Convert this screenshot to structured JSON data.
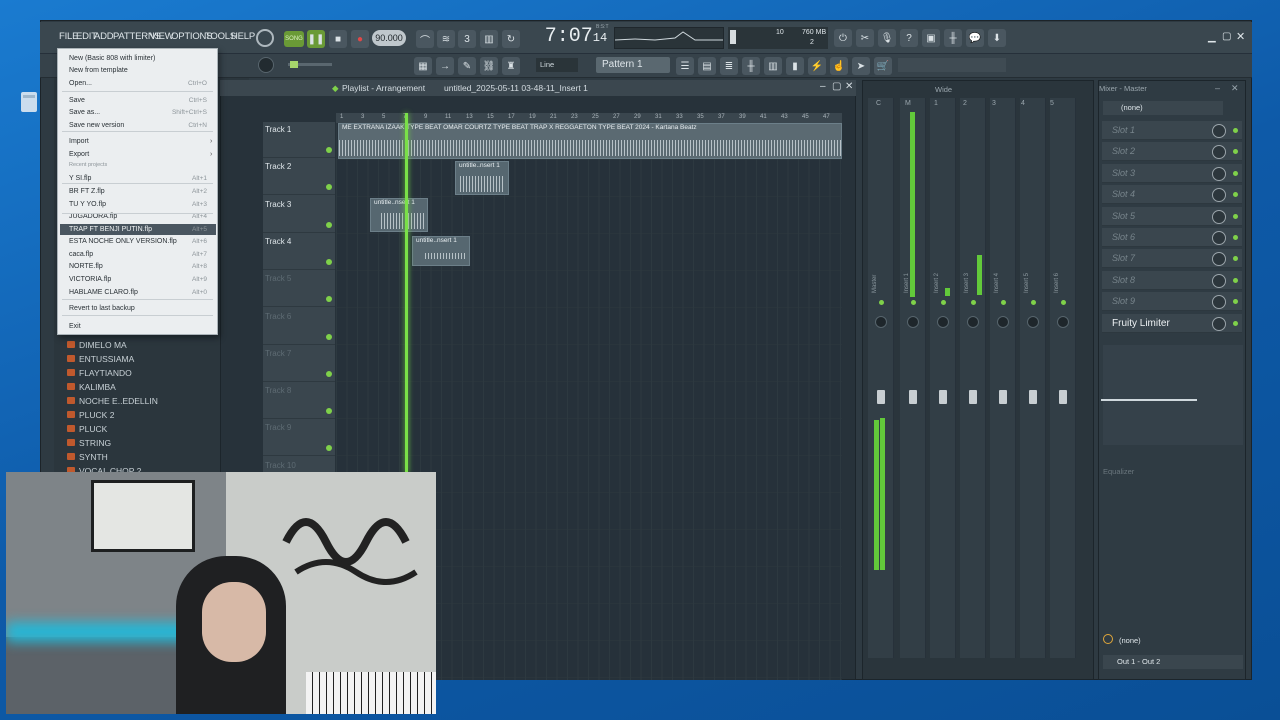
{
  "menubar": {
    "items": [
      "FILE",
      "EDIT",
      "ADD",
      "PATTERNS",
      "VIEW",
      "OPTIONS",
      "TOOLS",
      "HELP"
    ]
  },
  "transport": {
    "song_mode": "SONG",
    "tempo": "90.000",
    "time": "7:07",
    "time_sub": "14",
    "time_unit": "B:S:T",
    "cpu": "10",
    "memory": "760 MB",
    "voices": "2"
  },
  "toolbar2": {
    "snap": "Line",
    "pattern": "Pattern 1"
  },
  "file_menu": {
    "items": [
      {
        "label": "New (Basic 808 with limiter)",
        "key": ""
      },
      {
        "label": "New from template",
        "key": ""
      },
      {
        "label": "Open...",
        "key": "Ctrl+O"
      },
      {
        "label": "Save",
        "key": "Ctrl+S"
      },
      {
        "label": "Save as...",
        "key": "Shift+Ctrl+S"
      },
      {
        "label": "Save new version",
        "key": "Ctrl+N"
      },
      {
        "label": "Import",
        "key": ""
      },
      {
        "label": "Export",
        "key": ""
      },
      {
        "label": "Recent projects",
        "key": ""
      },
      {
        "label": "Y SI.flp",
        "key": "Alt+1"
      },
      {
        "label": "BR FT Z.flp",
        "key": "Alt+2"
      },
      {
        "label": "TU Y YO.flp",
        "key": "Alt+3"
      },
      {
        "label": "JUGADORA.flp",
        "key": "Alt+4"
      },
      {
        "label": "TRAP FT BENJI PUTIN.flp",
        "key": "Alt+5"
      },
      {
        "label": "ESTA NOCHE ONLY VERSION.flp",
        "key": "Alt+6"
      },
      {
        "label": "caca.flp",
        "key": "Alt+7"
      },
      {
        "label": "NORTE.flp",
        "key": "Alt+8"
      },
      {
        "label": "VICTORIA.flp",
        "key": "Alt+9"
      },
      {
        "label": "HABLAME CLARO.flp",
        "key": "Alt+0"
      },
      {
        "label": "Revert to last backup",
        "key": ""
      },
      {
        "label": "Exit",
        "key": ""
      }
    ]
  },
  "browser": {
    "folders": [
      "DIMELO MA",
      "ENTUSSIAMA",
      "FLAYTIANDO",
      "KALIMBA",
      "NOCHE E..EDELLIN",
      "PLUCK 2",
      "PLUCK",
      "STRING",
      "SYNTH",
      "VOCAL CHOP 2"
    ]
  },
  "playlist": {
    "title": "Playlist - Arrangement",
    "project": "untitled_2025-05-11 03-48-11_Insert 1",
    "ruler": [
      "1",
      "3",
      "5",
      "7",
      "9",
      "11",
      "13",
      "15",
      "17",
      "19",
      "21",
      "23",
      "25",
      "27",
      "29",
      "31",
      "33",
      "35",
      "37",
      "39",
      "41",
      "43",
      "45",
      "47"
    ],
    "tracks": [
      "Track 1",
      "Track 2",
      "Track 3",
      "Track 4",
      "Track 5",
      "Track 6",
      "Track 7",
      "Track 8",
      "Track 9",
      "Track 10"
    ],
    "clips": [
      {
        "label": "ME EXTRAÑA  IZAAK TYPE BEAT  OMAR COURTZ TYPE BEAT  TRAP X REGGAETON TYPE BEAT 2024 - Kartana Beatz"
      },
      {
        "label": "untitle..nsert 1"
      },
      {
        "label": "untitle..nsert 1"
      },
      {
        "label": "untitle..nsert 1"
      }
    ]
  },
  "mixer": {
    "title": "Mixer - Master",
    "view": "Wide",
    "strips": [
      "Master",
      "Insert 1",
      "Insert 2",
      "Insert 3",
      "Insert 4",
      "Insert 5",
      "Insert 6"
    ],
    "channel_numbers": [
      "C",
      "M",
      "1",
      "2",
      "3",
      "4",
      "5"
    ]
  },
  "fx": {
    "preset": "(none)",
    "slots": [
      "Slot 1",
      "Slot 2",
      "Slot 3",
      "Slot 4",
      "Slot 5",
      "Slot 6",
      "Slot 7",
      "Slot 8",
      "Slot 9"
    ],
    "limiter": "Fruity Limiter",
    "eq_label": "Equalizer",
    "output_none": "(none)",
    "output": "Out 1 - Out 2"
  }
}
